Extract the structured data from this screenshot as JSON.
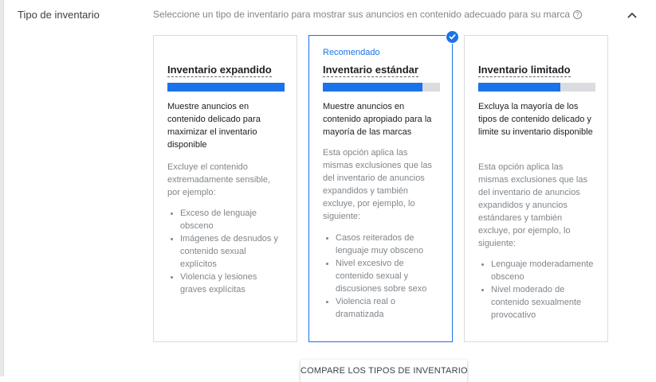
{
  "section": {
    "label": "Tipo de inventario",
    "description": "Seleccione un tipo de inventario para mostrar sus anuncios en contenido adecuado para su marca",
    "help_icon": "?",
    "collapse_icon": "chevron-up-icon"
  },
  "cards": [
    {
      "title": "Inventario expandido",
      "level": 1.0,
      "main_text": "Muestre anuncios en contenido delicado para maximizar el inventario disponible",
      "note": "Excluye el contenido extremadamente sensible, por ejemplo:",
      "items": [
        "Exceso de lenguaje obsceno",
        "Imágenes de desnudos y contenido sexual explícitos",
        "Violencia y lesiones graves explícitas"
      ],
      "selected": false
    },
    {
      "badge": "Recomendado",
      "title": "Inventario estándar",
      "level": 0.85,
      "main_text": "Muestre anuncios en contenido apropiado para la mayoría de las marcas",
      "note": "Esta opción aplica las mismas exclusiones que las del inventario de anuncios expandidos y también excluye, por ejemplo, lo siguiente:",
      "items": [
        "Casos reiterados de lenguaje muy obsceno",
        "Nivel excesivo de contenido sexual y discusiones sobre sexo",
        "Violencia real o dramatizada"
      ],
      "selected": true
    },
    {
      "title": "Inventario limitado",
      "level": 0.7,
      "main_text": "Excluya la mayoría de los tipos de contenido delicado y limite su inventario disponible",
      "note": "Esta opción aplica las mismas exclusiones que las del inventario de anuncios expandidos y anuncios estándares y también excluye, por ejemplo, lo siguiente:",
      "items": [
        "Lenguaje moderadamente obsceno",
        "Nivel moderado de contenido sexualmente provocativo"
      ],
      "selected": false
    }
  ],
  "compare_button": "COMPARE LOS TIPOS DE INVENTARIO",
  "colors": {
    "accent": "#1a73e8",
    "track": "#dadce0",
    "muted": "#80868b"
  }
}
